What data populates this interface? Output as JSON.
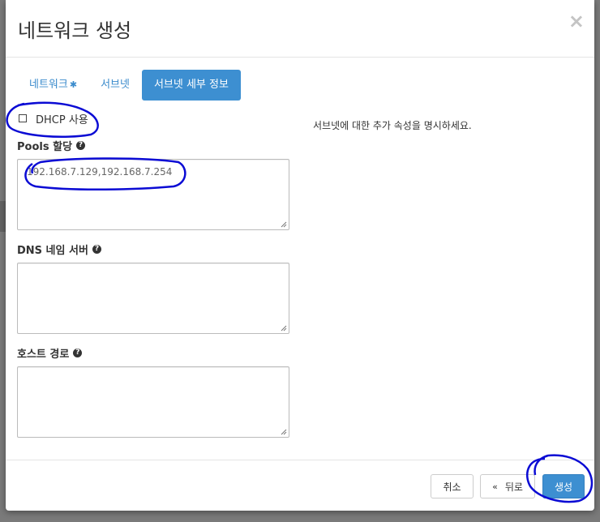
{
  "modal": {
    "title": "네트워크 생성",
    "close_symbol": "×"
  },
  "tabs": [
    {
      "label": "네트워크",
      "required_mark": "✱",
      "active": false
    },
    {
      "label": "서브넷",
      "active": false
    },
    {
      "label": "서브넷 세부 정보",
      "active": true
    }
  ],
  "form": {
    "dhcp_label": "DHCP 사용",
    "dhcp_checked": false,
    "pools_label": "Pools 할당",
    "pools_value": "192.168.7.129,192.168.7.254",
    "dns_label": "DNS 네임 서버",
    "dns_value": "",
    "hosts_label": "호스트 경로",
    "hosts_value": ""
  },
  "help_text": "서브넷에 대한 추가 속성을 명시하세요.",
  "footer": {
    "cancel_label": "취소",
    "back_label": "뒤로",
    "back_icon": "«",
    "create_label": "생성"
  },
  "colors": {
    "primary": "#3d8fd1",
    "link": "#3b8bcc",
    "annotation": "#0b0bd4"
  },
  "icons": {
    "help": "question-circle-icon",
    "close": "close-icon",
    "back": "double-chevron-left-icon"
  }
}
